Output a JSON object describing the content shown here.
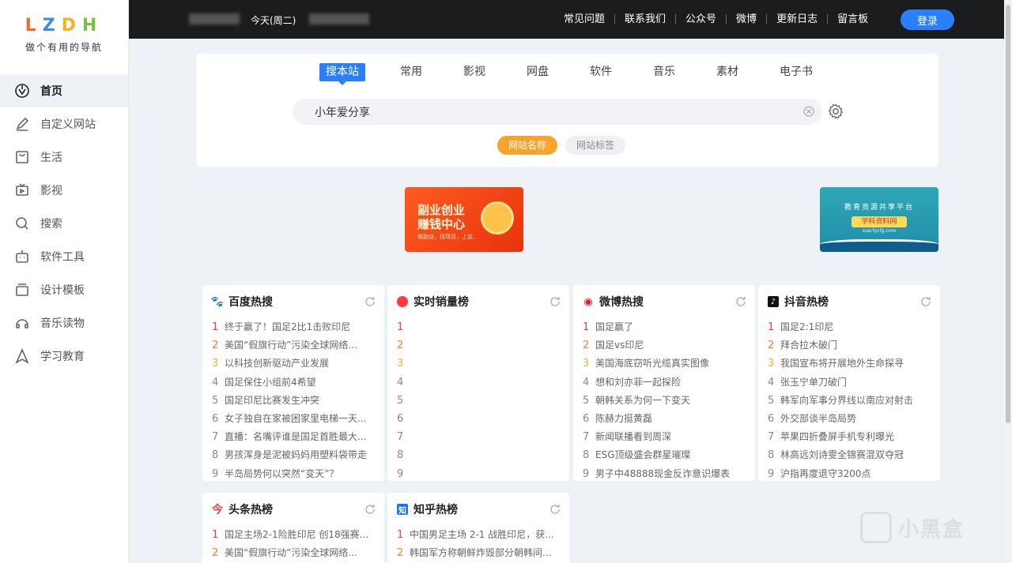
{
  "logo": {
    "letters": [
      "L",
      "Z",
      "D",
      "H"
    ],
    "slogan": "做个有用的导航"
  },
  "sidebar": {
    "items": [
      {
        "label": "首页",
        "icon": "home-icon",
        "active": true
      },
      {
        "label": "自定义网站",
        "icon": "edit-icon"
      },
      {
        "label": "生活",
        "icon": "bag-icon"
      },
      {
        "label": "影视",
        "icon": "tv-icon"
      },
      {
        "label": "搜索",
        "icon": "search-icon"
      },
      {
        "label": "软件工具",
        "icon": "robot-icon"
      },
      {
        "label": "设计模板",
        "icon": "layers-icon"
      },
      {
        "label": "音乐读物",
        "icon": "headphones-icon"
      },
      {
        "label": "学习教育",
        "icon": "triangle-icon"
      }
    ]
  },
  "topbar": {
    "date": "今天(周二)",
    "links": [
      "常见问题",
      "联系我们",
      "公众号",
      "微博",
      "更新日志",
      "留言板"
    ],
    "login": "登录"
  },
  "search": {
    "tabs": [
      "搜本站",
      "常用",
      "影视",
      "网盘",
      "软件",
      "音乐",
      "素材",
      "电子书"
    ],
    "active_tab": 0,
    "value": "小年爱分享",
    "sub_tabs": [
      "网站名称",
      "网站标签"
    ],
    "active_sub_tab": 0
  },
  "banners": {
    "left": {
      "title": "副业创业 赚钱中心",
      "sub": "做副业，找项目，上这..."
    },
    "right": {
      "title": "教育资源共享平台",
      "mark": "学科资料网",
      "url": "xue.fycfg.com"
    }
  },
  "colors": {
    "accent": "#2b7fff",
    "orange": "#f8a42c",
    "rank1": "#e93e3e",
    "rank2": "#ff7a2e",
    "rank3": "#f5b320"
  },
  "cards": [
    {
      "title": "百度热搜",
      "icon": "baidu-icon",
      "items": [
        "终于赢了！国足2比1击败印尼",
        "美国“假旗行动”污染全球网络...",
        "以科技创新驱动产业发展",
        "国足保住小组前4希望",
        "国足印尼比赛发生冲突",
        "女子独自在家被困家里电梯一天...",
        "直播：名嘴评谁是国足首胜最大...",
        "男孩浑身是泥被妈妈用塑料袋带走",
        "半岛局势何以突然“变天”？"
      ]
    },
    {
      "title": "实时销量榜",
      "icon": "shopping-bag-icon",
      "items": [
        "",
        "",
        "",
        "",
        "",
        "",
        "",
        "",
        ""
      ]
    },
    {
      "title": "微博热搜",
      "icon": "weibo-icon",
      "items": [
        "国足赢了",
        "国足vs印尼",
        "美国海底窃听光缆真实图像",
        "想和刘亦菲一起探险",
        "朝韩关系为何一下变天",
        "陈赫力挺黄磊",
        "新闻联播看到周深",
        "ESG顶级盛会群星璀璨",
        "男子中48888现金反诈意识爆表"
      ]
    },
    {
      "title": "抖音热榜",
      "icon": "douyin-icon",
      "items": [
        "国足2:1印尼",
        "拜合拉木破门",
        "我国宣布将开展地外生命探寻",
        "张玉宁单刀破门",
        "韩军向军事分界线以南应对射击",
        "外交部谈半岛局势",
        "苹果四折叠屏手机专利曝光",
        "林高远刘诗雯全锦赛混双夺冠",
        "沪指再度退守3200点"
      ]
    },
    {
      "title": "头条热榜",
      "icon": "toutiao-icon",
      "items": [
        "国足主场2-1险胜印尼 创18强赛...",
        "美国“假旗行动”污染全球网络..."
      ]
    },
    {
      "title": "知乎热榜",
      "icon": "zhihu-icon",
      "items": [
        "中国男足主场 2-1 战胜印尼，获...",
        "韩国军方称朝鲜炸毁部分朝韩间..."
      ]
    }
  ],
  "watermark": "小黑盒"
}
